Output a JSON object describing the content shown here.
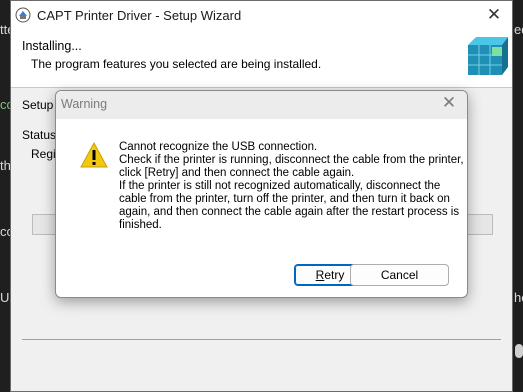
{
  "window": {
    "title": "CAPT Printer Driver - Setup Wizard",
    "close_glyph": "✕",
    "header_title": "Installing...",
    "header_subtitle": "The program features you selected are being installed.",
    "setup_label": "Setup W",
    "status_label": "Status:",
    "status_value": "Regis",
    "progress_fraction": 0.0
  },
  "dialog": {
    "title": "Warning",
    "close_glyph": "✕",
    "message": "Cannot recognize the USB connection.\nCheck if the printer is running, disconnect the cable from the printer, click [Retry] and then connect the cable again.\nIf the printer is still not recognized automatically, disconnect the cable from the printer, turn off the printer, and then turn it back on again, and then connect the cable again after the restart process is finished.",
    "retry_first": "R",
    "retry_rest": "etry",
    "cancel_label": "Cancel"
  },
  "background": {
    "frag_top": "tte",
    "frag_co": "co",
    "frag_th": "th",
    "frag_cc": "cc",
    "frag_us": "Us",
    "frag_he": "he",
    "frag_ed": "ed",
    "frag_r": "r"
  },
  "icons": {
    "app": "printer-setup-icon",
    "header": "blue-cubes-icon",
    "warning": "warning-triangle-icon"
  },
  "colors": {
    "accent": "#0067c0",
    "warning_yellow": "#f2c811",
    "cubes_teal": "#2aa8c9"
  }
}
